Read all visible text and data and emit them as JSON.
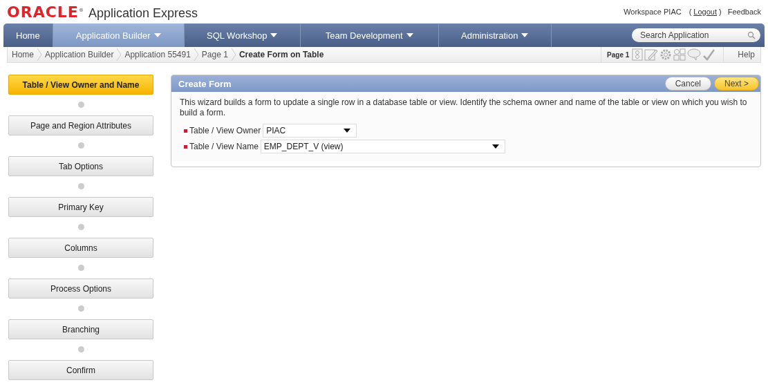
{
  "header": {
    "logo": "ORACLE",
    "logo_mark": "®",
    "product": "Application Express",
    "workspace": "Workspace PIAC",
    "logout_open": "(",
    "logout": "Logout",
    "logout_close": ")",
    "feedback": "Feedback"
  },
  "tabs": [
    {
      "label": "Home",
      "selected": false,
      "menu": false
    },
    {
      "label": "Application Builder",
      "selected": true,
      "menu": true
    },
    {
      "label": "SQL Workshop",
      "selected": false,
      "menu": true
    },
    {
      "label": "Team Development",
      "selected": false,
      "menu": true
    },
    {
      "label": "Administration",
      "selected": false,
      "menu": true
    }
  ],
  "search": {
    "placeholder": "Search Application"
  },
  "breadcrumb": [
    {
      "label": "Home",
      "current": false
    },
    {
      "label": "Application Builder",
      "current": false
    },
    {
      "label": "Application 55491",
      "current": false
    },
    {
      "label": "Page 1",
      "current": false
    },
    {
      "label": "Create Form on Table",
      "current": true
    }
  ],
  "page_tools": {
    "label": "Page 1",
    "help": "Help"
  },
  "steps": [
    {
      "label": "Table / View Owner and Name",
      "selected": true
    },
    {
      "label": "Page and Region Attributes",
      "selected": false
    },
    {
      "label": "Tab Options",
      "selected": false
    },
    {
      "label": "Primary Key",
      "selected": false
    },
    {
      "label": "Columns",
      "selected": false
    },
    {
      "label": "Process Options",
      "selected": false
    },
    {
      "label": "Branching",
      "selected": false
    },
    {
      "label": "Confirm",
      "selected": false
    }
  ],
  "region": {
    "title": "Create Form",
    "buttons": [
      {
        "label": "Cancel",
        "kind": "secondary"
      },
      {
        "label": "Next >",
        "kind": "primary"
      }
    ],
    "description": "This wizard builds a form to update a single row in a database table or view. Identify the schema owner and name of the table or view on which you wish to build a form.",
    "fields": [
      {
        "label": "Table / View Owner",
        "value": "PIAC",
        "required": true
      },
      {
        "label": "Table / View Name",
        "value": "EMP_DEPT_V (view)",
        "required": true
      }
    ]
  }
}
